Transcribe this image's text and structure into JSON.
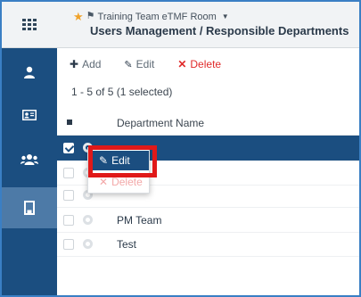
{
  "header": {
    "room_name": "Training Team eTMF Room",
    "page_title": "Users Management / Responsible Departments"
  },
  "sidebar": {
    "items": [
      {
        "icon": "apps-grid-icon"
      },
      {
        "icon": "user-icon"
      },
      {
        "icon": "id-card-icon"
      },
      {
        "icon": "users-group-icon"
      },
      {
        "icon": "building-icon",
        "active": true
      }
    ]
  },
  "toolbar": {
    "add_label": "Add",
    "edit_label": "Edit",
    "delete_label": "Delete"
  },
  "grid": {
    "count_text": "1 - 5 of 5 (1 selected)",
    "column_header": "Department Name",
    "rows": [
      {
        "name": "",
        "selected": true
      },
      {
        "name": "",
        "selected": false
      },
      {
        "name": "",
        "selected": false
      },
      {
        "name": "PM Team",
        "selected": false
      },
      {
        "name": "Test",
        "selected": false
      }
    ]
  },
  "context_menu": {
    "edit_label": "Edit",
    "delete_label": "Delete"
  },
  "colors": {
    "sidebar": "#1b4e80",
    "selected_row": "#1b4e80",
    "delete": "#e02a2a",
    "highlight": "#e01919",
    "star": "#f0a22a"
  }
}
